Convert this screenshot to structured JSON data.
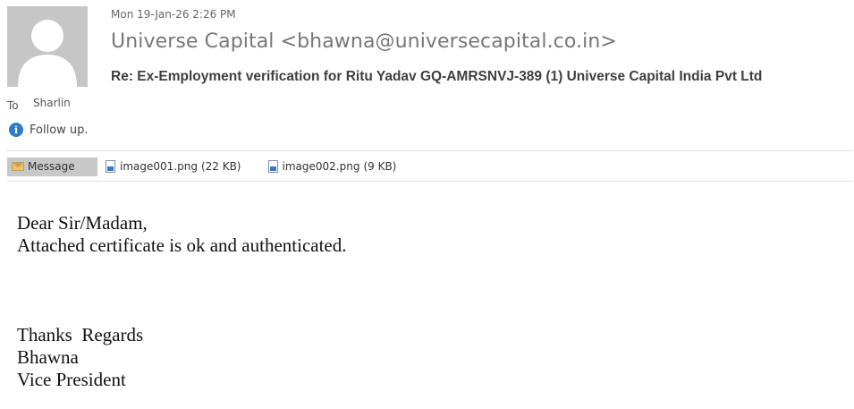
{
  "email": {
    "sent": "Mon 19-Jan-26 2:26 PM",
    "sender": "Universe Capital <bhawna@universecapital.co.in>",
    "subject": "Re: Ex-Employment verification for Ritu Yadav GQ-AMRSNVJ-389 (1) Universe Capital India Pvt Ltd",
    "to_label": "To",
    "to_name": "Sharlin",
    "flag_text": "Follow up.",
    "tabs": {
      "message": "Message"
    },
    "attachments": [
      {
        "name": "image001.png",
        "size": "(22 KB)"
      },
      {
        "name": "image002.png",
        "size": "(9 KB)"
      }
    ],
    "body": {
      "greeting": "Dear Sir/Madam,",
      "line1": "Attached certificate is ok and authenticated.",
      "sign1": "Thanks  Regards",
      "sign2": "Bhawna",
      "sign3": "Vice President"
    }
  }
}
